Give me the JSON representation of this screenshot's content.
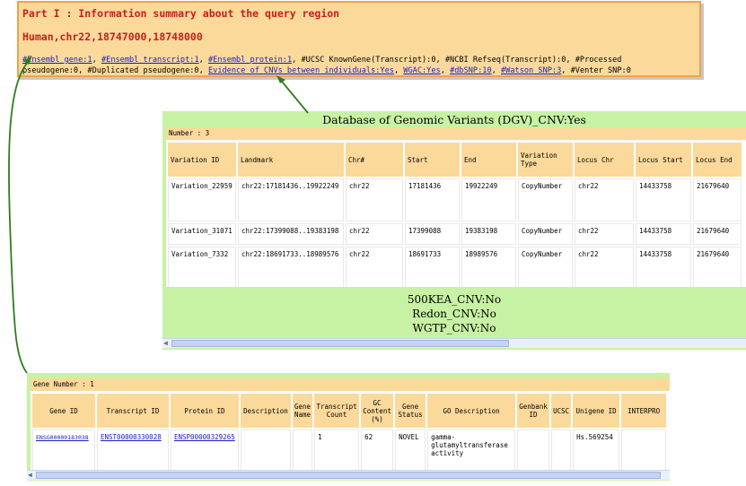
{
  "summary": {
    "part_title": "Part I : Information summary about the query region",
    "region": "Human,chr22,18747000,18748000",
    "line1": {
      "ensembl_gene": "#Ensembl gene:1",
      "ensembl_transcript": "#Ensembl transcript:1",
      "ensembl_protein": "#Ensembl protein:1",
      "rest": ", #UCSC KnownGene(Transcript):0, #NCBI Refseq(Transcript):0, #Processed"
    },
    "line2": {
      "prefix": "pseudogene:0, #Duplicated pseudogene:0, ",
      "cnv": "Evidence of CNVs between individuals:Yes",
      "wgac": "WGAC:Yes",
      "dbsnp": "#dbSNP:10",
      "watson": "#Watson SNP:3",
      "venter": ", #Venter SNP:0"
    }
  },
  "dgv": {
    "title": "Database of Genomic Variants (DGV)_CNV:Yes",
    "number": "Number : 3",
    "headers": [
      "Variation ID",
      "Landmark",
      "Chr#",
      "Start",
      "End",
      "Variation Type",
      "Locus Chr",
      "Locus Start",
      "Locus End"
    ],
    "rows": [
      [
        "Variation_22959",
        "chr22:17181436..19922249",
        "chr22",
        "17181436",
        "19922249",
        "CopyNumber",
        "chr22",
        "14433758",
        "21679640"
      ],
      [
        "Variation_31071",
        "chr22:17399088..19383198",
        "chr22",
        "17399088",
        "19383198",
        "CopyNumber",
        "chr22",
        "14433758",
        "21679640"
      ],
      [
        "Variation_7332",
        "chr22:18691733..18989576",
        "chr22",
        "18691733",
        "18989576",
        "CopyNumber",
        "chr22",
        "14433758",
        "21679640"
      ]
    ],
    "others": [
      "500KEA_CNV:No",
      "Redon_CNV:No",
      "WGTP_CNV:No"
    ]
  },
  "gene": {
    "number": "Gene Number : 1",
    "headers": [
      "Gene ID",
      "Transcript ID",
      "Protein ID",
      "Description",
      "Gene Name",
      "Transcript Count",
      "GC Content (%)",
      "Gene Status",
      "GO Description",
      "Genbank ID",
      "UCSC",
      "Unigene ID",
      "INTERPRO"
    ],
    "row": {
      "gene_id": "ENSG00000183038",
      "transcript_id": "ENST00000330028",
      "protein_id": "ENSP00000329265",
      "description": "",
      "gene_name": "",
      "transcript_count": "1",
      "gc_content": "62",
      "gene_status": "NOVEL",
      "go_description": "gamma-glutamyltransferase activity",
      "genbank_id": "",
      "ucsc": "",
      "unigene_id": "Hs.569254",
      "interpro": ""
    }
  },
  "colors": {
    "panel_orange": "#fbd99b",
    "panel_green": "#c7f2a3",
    "title_red": "#c81e1e",
    "link_blue": "#1a1ac8",
    "connector_green": "#2e7d1e"
  }
}
